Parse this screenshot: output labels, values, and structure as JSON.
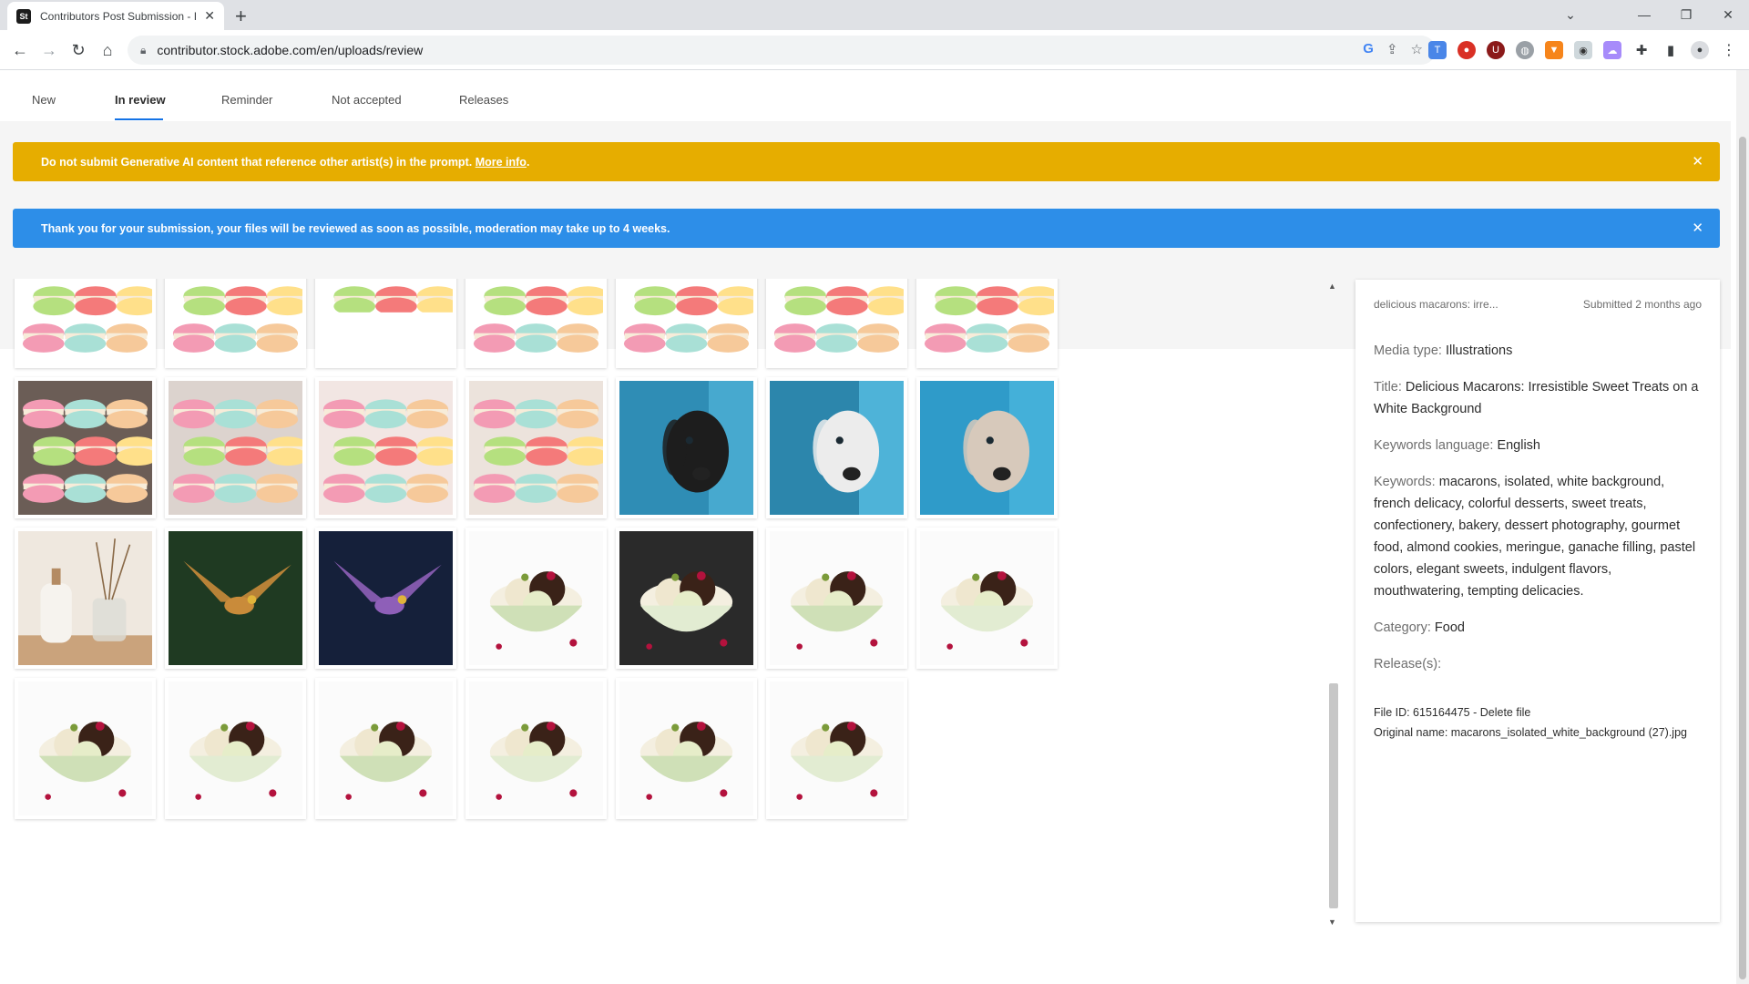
{
  "browser": {
    "tab_title": "Contributors Post Submission - I",
    "url": "contributor.stock.adobe.com/en/uploads/review",
    "favicon_text": "St"
  },
  "subnav": {
    "items": [
      "New",
      "In review",
      "Reminder",
      "Not accepted",
      "Releases"
    ],
    "active": "In review"
  },
  "alerts": {
    "warning_text": "Do not submit Generative AI content that reference other artist(s) in the prompt.",
    "warning_link": "More info",
    "warning_suffix": ".",
    "info_text": "Thank you for your submission, your files will be reviewed as soon as possible, moderation may take up to 4 weeks."
  },
  "grid": {
    "thumbnails": [
      {
        "subject": "macarons"
      },
      {
        "subject": "macarons"
      },
      {
        "subject": "macarons"
      },
      {
        "subject": "macarons"
      },
      {
        "subject": "macarons"
      },
      {
        "subject": "macarons"
      },
      {
        "subject": "macarons"
      },
      {
        "subject": "macarons"
      },
      {
        "subject": "macarons"
      },
      {
        "subject": "macarons"
      },
      {
        "subject": "macarons"
      },
      {
        "subject": "dog"
      },
      {
        "subject": "dog"
      },
      {
        "subject": "dog"
      },
      {
        "subject": "reed-diffuser"
      },
      {
        "subject": "hummingbird"
      },
      {
        "subject": "bird"
      },
      {
        "subject": "ice-cream"
      },
      {
        "subject": "ice-cream"
      },
      {
        "subject": "ice-cream"
      },
      {
        "subject": "ice-cream"
      },
      {
        "subject": "ice-cream"
      },
      {
        "subject": "ice-cream"
      },
      {
        "subject": "ice-cream"
      },
      {
        "subject": "ice-cream"
      },
      {
        "subject": "ice-cream"
      },
      {
        "subject": "ice-cream"
      }
    ]
  },
  "panel": {
    "short_title": "delicious macarons: irre...",
    "submitted": "Submitted 2 months ago",
    "media_type_label": "Media type:",
    "media_type": "Illustrations",
    "title_label": "Title:",
    "title": "Delicious Macarons: Irresistible Sweet Treats on a White Background",
    "keywords_language_label": "Keywords language:",
    "keywords_language": "English",
    "keywords_label": "Keywords:",
    "keywords": "macarons, isolated, white background, french delicacy, colorful desserts, sweet treats, confectionery, bakery, dessert photography, gourmet food, almond cookies, meringue, ganache filling, pastel colors, elegant sweets, indulgent flavors, mouthwatering, tempting delicacies.",
    "category_label": "Category:",
    "category": "Food",
    "releases_label": "Release(s):",
    "file_id_label": "File ID: 615164475 - ",
    "delete_label": "Delete file",
    "original_name_label": "Original name:",
    "original_name": "macarons_isolated_white_background (27).jpg"
  },
  "colors": {
    "warning": "#e6ad00",
    "info": "#2d8ee8",
    "accent": "#1473e6"
  }
}
